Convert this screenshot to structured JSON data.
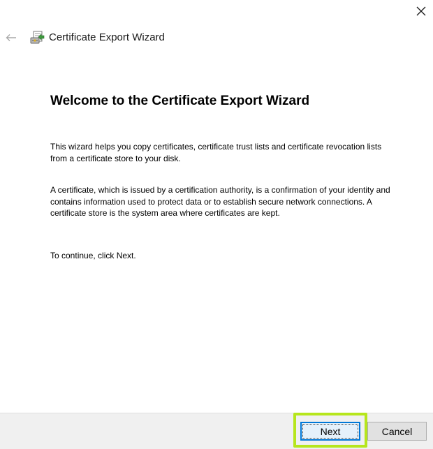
{
  "window": {
    "title": "Certificate Export Wizard",
    "close_icon": "close-icon",
    "back_icon": "back-arrow-icon",
    "app_icon": "certificate-export-icon"
  },
  "content": {
    "heading": "Welcome to the Certificate Export Wizard",
    "paragraph1": "This wizard helps you copy certificates, certificate trust lists and certificate revocation lists from a certificate store to your disk.",
    "paragraph2": "A certificate, which is issued by a certification authority, is a confirmation of your identity and contains information used to protect data or to establish secure network connections. A certificate store is the system area where certificates are kept.",
    "paragraph3": "To continue, click Next."
  },
  "footer": {
    "next_label": "Next",
    "cancel_label": "Cancel"
  },
  "colors": {
    "highlight": "#b6e61c",
    "focus_border": "#0078d7",
    "footer_bg": "#f0f0f0"
  }
}
